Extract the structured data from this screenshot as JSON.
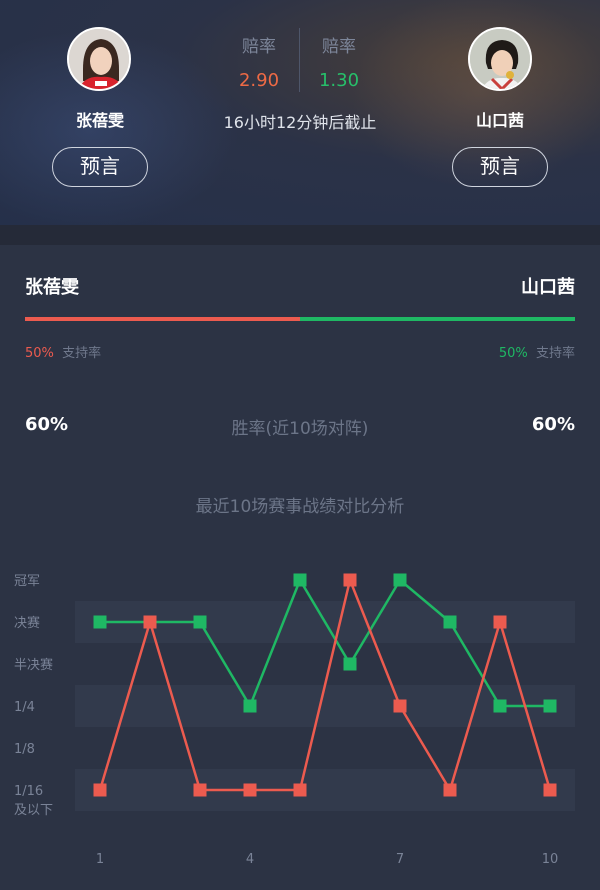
{
  "header": {
    "left_player": {
      "name": "张蓓雯",
      "predict_label": "预言"
    },
    "right_player": {
      "name": "山口茜",
      "predict_label": "预言"
    },
    "odds": {
      "left": {
        "label": "赔率",
        "value": "2.90"
      },
      "right": {
        "label": "赔率",
        "value": "1.30"
      }
    },
    "deadline": "16小时12分钟后截止"
  },
  "support": {
    "left": {
      "name": "张蓓雯",
      "pct": "50%",
      "label": "支持率"
    },
    "right": {
      "name": "山口茜",
      "pct": "50%",
      "label": "支持率"
    }
  },
  "winrate": {
    "left": "60%",
    "right": "60%",
    "label": "胜率(近10场对阵)"
  },
  "colors": {
    "red": "#ec5b4f",
    "green": "#1fb864",
    "odds_left": "#ee6a45",
    "odds_right": "#27bf6a"
  },
  "chart_data": {
    "type": "line",
    "title": "最近10场赛事战绩对比分析",
    "x": [
      1,
      2,
      3,
      4,
      5,
      6,
      7,
      8,
      9,
      10
    ],
    "x_tick_labels": [
      "1",
      "4",
      "7",
      "10"
    ],
    "x_tick_values": [
      1,
      4,
      7,
      10
    ],
    "y_categories": [
      "1/16\n及以下",
      "1/8",
      "1/4",
      "半决赛",
      "决赛",
      "冠军"
    ],
    "series": [
      {
        "color": "#1fb864",
        "values": [
          4,
          4,
          4,
          2,
          5,
          3,
          5,
          4,
          2,
          2
        ]
      },
      {
        "color": "#ec5b4f",
        "values": [
          0,
          4,
          0,
          0,
          0,
          5,
          2,
          0,
          4,
          0
        ]
      }
    ],
    "grid": true,
    "legend": "none"
  }
}
